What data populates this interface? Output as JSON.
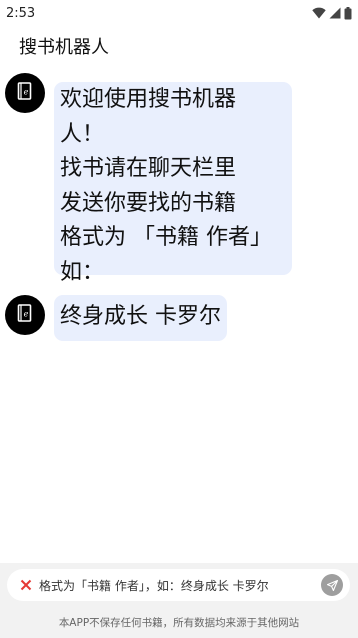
{
  "status_bar": {
    "time": "2:53",
    "icons": [
      "wifi-icon",
      "signal-icon",
      "battery-icon"
    ]
  },
  "app_bar": {
    "title": "搜书机器人"
  },
  "messages": [
    {
      "avatar_icon": "ebook-icon",
      "lines": [
        "欢迎使用搜书机器",
        "人！",
        "找书请在聊天栏里",
        "发送你要找的书籍",
        "格式为 「书籍 作者」",
        "如："
      ]
    },
    {
      "avatar_icon": "ebook-icon",
      "text": "终身成长 卡罗尔"
    }
  ],
  "input": {
    "value": "格式为「书籍 作者」，如：终身成长 卡罗尔",
    "clear_icon": "close-icon",
    "send_icon": "send-icon"
  },
  "footer": {
    "notice": "本APP不保存任何书籍，所有数据均来源于其他网站"
  },
  "colors": {
    "bubble": "#e9effd",
    "avatar": "#000000",
    "clear_icon": "#e53935",
    "send_button": "#9e9e9e",
    "input_bar": "#f2f2f2"
  }
}
